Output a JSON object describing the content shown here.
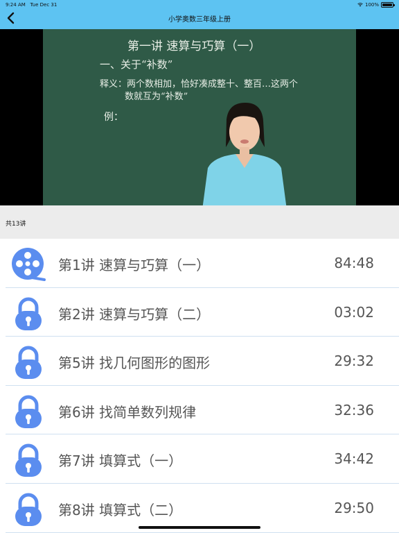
{
  "status_bar": {
    "time": "9:24 AM",
    "date": "Tue Dec 31",
    "battery": "100%",
    "battery_level": 1.0
  },
  "nav": {
    "title": "小学奥数三年级上册",
    "back_icon": "chevron-left-icon"
  },
  "video": {
    "board_lines": [
      "第一讲 速算与巧算（一）",
      "一、关于“补数”",
      "释义：两个数相加，恰好凑成整十、整百…这两个",
      "数就互为“补数”",
      "例："
    ]
  },
  "list_header": {
    "count_label": "共13讲"
  },
  "lessons": [
    {
      "title": "第1讲 速算与巧算（一）",
      "duration": "84:48",
      "icon": "video-reel-icon"
    },
    {
      "title": "第2讲 速算与巧算（二）",
      "duration": "03:02",
      "icon": "lock-icon"
    },
    {
      "title": "第5讲 找几何图形的图形",
      "duration": "29:32",
      "icon": "lock-icon"
    },
    {
      "title": "第6讲 找简单数列规律",
      "duration": "32:36",
      "icon": "lock-icon"
    },
    {
      "title": "第7讲 填算式（一）",
      "duration": "34:42",
      "icon": "lock-icon"
    },
    {
      "title": "第8讲 填算式（二）",
      "duration": "29:50",
      "icon": "lock-icon"
    }
  ],
  "colors": {
    "nav_background": "#5dc3f2",
    "icon_blue": "#5b8def",
    "chalkboard": "#2f5a47",
    "count_bar": "#ececec"
  }
}
